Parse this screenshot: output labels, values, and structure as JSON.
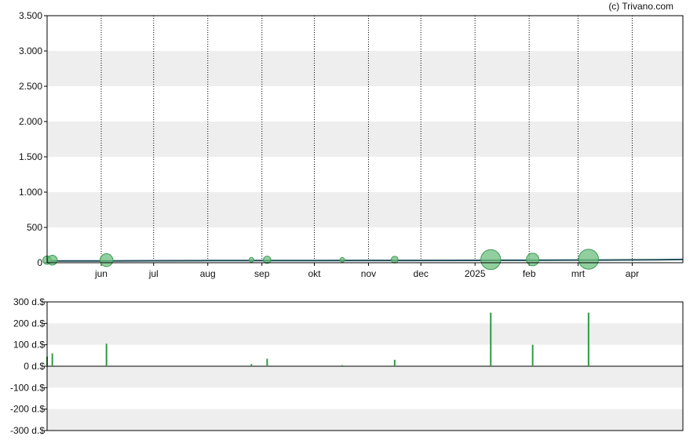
{
  "credit": "(c) Trivano.com",
  "colors": {
    "background": "#ffffff",
    "band": "#eeeeee",
    "axis": "#000000",
    "line": "#1f4e5a",
    "bubble_fill": "#6cbf7e",
    "bubble_stroke": "#3a9a55",
    "volume_bar": "#2e9a45"
  },
  "chart_data": [
    {
      "type": "line",
      "id": "price",
      "grid": true,
      "banded_background": true,
      "ylim": [
        0,
        3500
      ],
      "y_ticks": [
        {
          "value": 0,
          "label": "0"
        },
        {
          "value": 500,
          "label": "500"
        },
        {
          "value": 1000,
          "label": "1.000"
        },
        {
          "value": 1500,
          "label": "1.500"
        },
        {
          "value": 2000,
          "label": "2.000"
        },
        {
          "value": 2500,
          "label": "2.500"
        },
        {
          "value": 3000,
          "label": "3.000"
        },
        {
          "value": 3500,
          "label": "3.500"
        }
      ],
      "xlim": [
        "2024-05-01",
        "2025-04-30"
      ],
      "x_ticks": [
        {
          "date": "2024-06-01",
          "label": "jun"
        },
        {
          "date": "2024-07-01",
          "label": "jul"
        },
        {
          "date": "2024-08-01",
          "label": "aug"
        },
        {
          "date": "2024-09-01",
          "label": "sep"
        },
        {
          "date": "2024-10-01",
          "label": "okt"
        },
        {
          "date": "2024-11-01",
          "label": "nov"
        },
        {
          "date": "2024-12-01",
          "label": "dec"
        },
        {
          "date": "2025-01-01",
          "label": "2025"
        },
        {
          "date": "2025-02-01",
          "label": "feb"
        },
        {
          "date": "2025-03-01",
          "label": "mrt"
        },
        {
          "date": "2025-04-01",
          "label": "apr"
        }
      ],
      "series": [
        {
          "x": [
            "2024-05-01",
            "2024-05-10",
            "2024-06-01",
            "2024-07-01",
            "2024-08-01",
            "2024-09-01",
            "2024-10-01",
            "2024-11-01",
            "2024-12-01",
            "2025-01-01",
            "2025-01-15",
            "2025-02-01",
            "2025-03-01",
            "2025-03-15",
            "2025-04-01",
            "2025-04-15",
            "2025-04-30"
          ],
          "y": [
            25,
            25,
            25,
            28,
            30,
            30,
            30,
            32,
            32,
            33,
            35,
            35,
            38,
            38,
            40,
            42,
            45
          ]
        }
      ],
      "transaction_bubbles": [
        {
          "date": "2024-05-01",
          "price": 25,
          "volume": 45
        },
        {
          "date": "2024-05-04",
          "price": 25,
          "volume": 60
        },
        {
          "date": "2024-06-04",
          "price": 25,
          "volume": 105
        },
        {
          "date": "2024-08-26",
          "price": 30,
          "volume": 10
        },
        {
          "date": "2024-09-04",
          "price": 30,
          "volume": 35
        },
        {
          "date": "2024-10-17",
          "price": 30,
          "volume": 5
        },
        {
          "date": "2024-11-16",
          "price": 32,
          "volume": 30
        },
        {
          "date": "2025-01-10",
          "price": 33,
          "volume": 250
        },
        {
          "date": "2025-02-03",
          "price": 35,
          "volume": 100
        },
        {
          "date": "2025-03-07",
          "price": 38,
          "volume": 250
        }
      ]
    },
    {
      "type": "bar",
      "id": "volume",
      "grid": true,
      "banded_background": true,
      "ylim": [
        -300,
        300
      ],
      "y_ticks": [
        {
          "value": 300,
          "label": "300 d.$"
        },
        {
          "value": 200,
          "label": "200 d.$"
        },
        {
          "value": 100,
          "label": "100 d.$"
        },
        {
          "value": 0,
          "label": "0 d.$"
        },
        {
          "value": -100,
          "label": "-100 d.$"
        },
        {
          "value": -200,
          "label": "-200 d.$"
        },
        {
          "value": -300,
          "label": "-300 d.$"
        }
      ],
      "xlim": [
        "2024-05-01",
        "2025-04-30"
      ],
      "x": [
        "2024-05-01",
        "2024-05-04",
        "2024-06-04",
        "2024-08-26",
        "2024-09-04",
        "2024-10-17",
        "2024-11-16",
        "2025-01-10",
        "2025-02-03",
        "2025-03-07"
      ],
      "values": [
        45,
        60,
        105,
        10,
        35,
        5,
        30,
        250,
        100,
        250
      ]
    }
  ]
}
